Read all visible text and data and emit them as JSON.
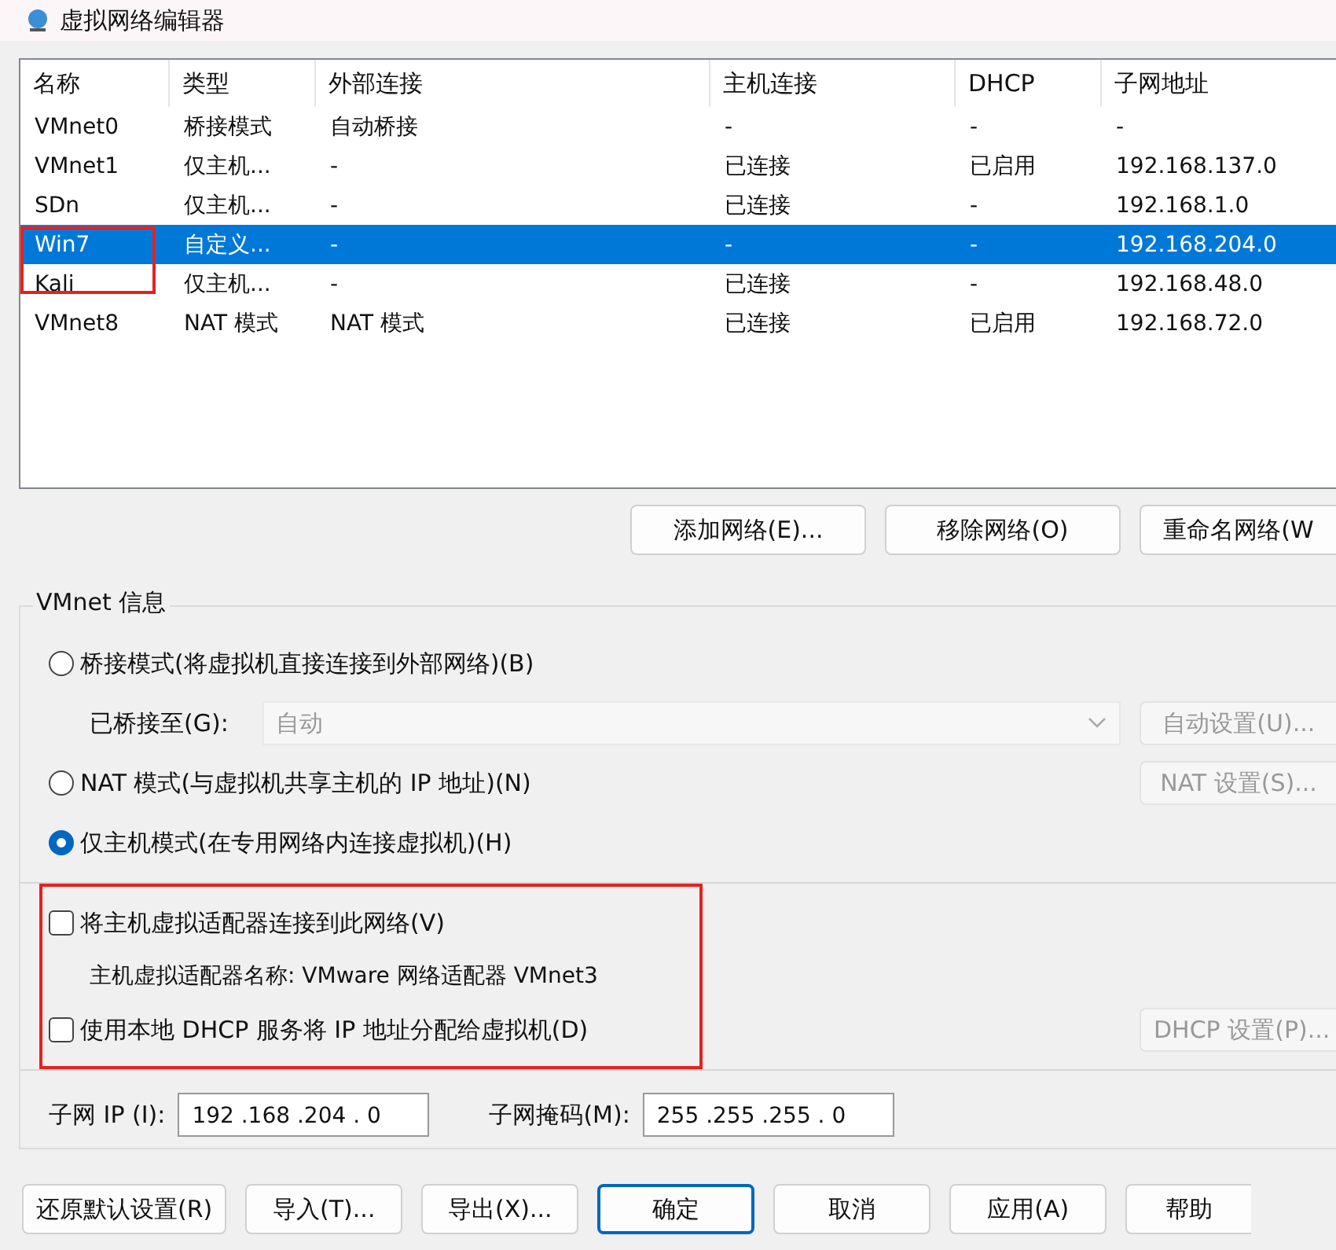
{
  "window": {
    "title": "虚拟网络编辑器"
  },
  "network_table": {
    "columns": [
      "名称",
      "类型",
      "外部连接",
      "主机连接",
      "DHCP",
      "子网地址"
    ],
    "rows": [
      {
        "cells": [
          "VMnet0",
          "桥接模式",
          "自动桥接",
          "-",
          "-",
          "-"
        ],
        "selected": false
      },
      {
        "cells": [
          "VMnet1",
          "仅主机...",
          "-",
          "已连接",
          "已启用",
          "192.168.137.0"
        ],
        "selected": false
      },
      {
        "cells": [
          "SDn",
          "仅主机...",
          "-",
          "已连接",
          "-",
          "192.168.1.0"
        ],
        "selected": false
      },
      {
        "cells": [
          "Win7",
          "自定义...",
          "-",
          "-",
          "-",
          "192.168.204.0"
        ],
        "selected": true
      },
      {
        "cells": [
          "Kali",
          "仅主机...",
          "-",
          "已连接",
          "-",
          "192.168.48.0"
        ],
        "selected": false
      },
      {
        "cells": [
          "VMnet8",
          "NAT 模式",
          "NAT 模式",
          "已连接",
          "已启用",
          "192.168.72.0"
        ],
        "selected": false
      }
    ]
  },
  "network_buttons": [
    "添加网络(E)...",
    "移除网络(O)",
    "重命名网络(W"
  ],
  "vmnet_info": {
    "title": "VMnet 信息",
    "modes": [
      {
        "label": "桥接模式(将虚拟机直接连接到外部网络)(B)",
        "selected": false
      },
      {
        "label": "NAT 模式(与虚拟机共享主机的 IP 地址)(N)",
        "selected": false
      },
      {
        "label": "仅主机模式(在专用网络内连接虚拟机)(H)",
        "selected": true
      }
    ],
    "bridged_to": {
      "label": "已桥接至(G):",
      "value": "自动",
      "disabled": true
    },
    "auto_settings_button": {
      "label": "自动设置(U)...",
      "disabled": true
    },
    "nat_settings_button": {
      "label": "NAT 设置(S)...",
      "disabled": true
    },
    "connect_adapter": {
      "label": "将主机虚拟适配器连接到此网络(V)",
      "checked": false
    },
    "adapter_name": "主机虚拟适配器名称: VMware 网络适配器 VMnet3",
    "local_dhcp": {
      "label": "使用本地 DHCP 服务将 IP 地址分配给虚拟机(D)",
      "checked": false
    },
    "dhcp_settings_button": {
      "label": "DHCP 设置(P)...",
      "disabled": true
    },
    "subnet_ip": {
      "label": "子网 IP (I):",
      "value": "192 .168 .204 .  0"
    },
    "subnet_mask": {
      "label": "子网掩码(M):",
      "value": "255 .255 .255 .  0"
    }
  },
  "footer_buttons": [
    {
      "label": "还原默认设置(R)",
      "default": false
    },
    {
      "label": "导入(T)...",
      "default": false
    },
    {
      "label": "导出(X)...",
      "default": false
    },
    {
      "label": "确定",
      "default": true
    },
    {
      "label": "取消",
      "default": false
    },
    {
      "label": "应用(A)",
      "default": false
    },
    {
      "label": "帮助",
      "default": false
    }
  ]
}
